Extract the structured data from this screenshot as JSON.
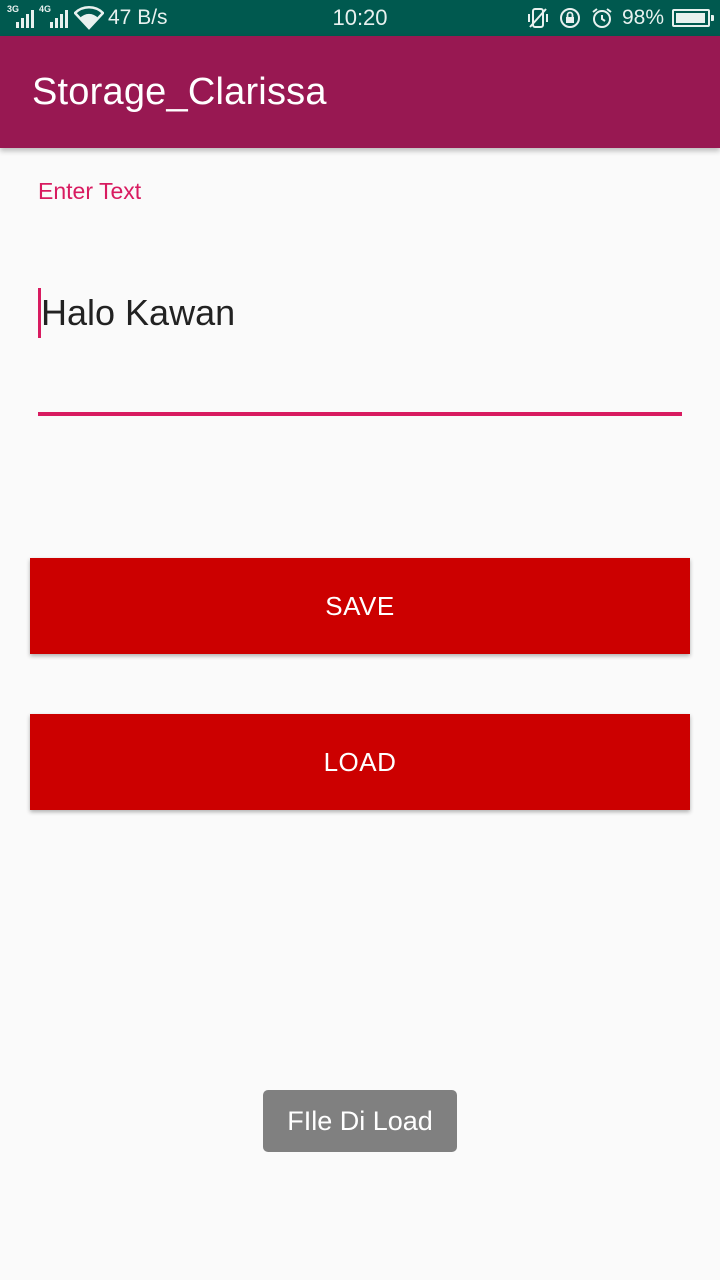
{
  "status_bar": {
    "network_speed": "47 B/s",
    "time": "10:20",
    "battery_percent": "98%",
    "battery_level": 0.98,
    "signal_tags": [
      "3G",
      "4G"
    ],
    "icons": [
      "signal-icon",
      "wifi-icon",
      "vibrate-icon",
      "rotation-lock-icon",
      "alarm-icon",
      "battery-icon"
    ]
  },
  "app_bar": {
    "title": "Storage_Clarissa",
    "color": "#981852"
  },
  "form": {
    "label": "Enter Text",
    "value": "Halo Kawan",
    "accent_color": "#d81b60"
  },
  "buttons": {
    "save_label": "SAVE",
    "load_label": "LOAD",
    "color": "#cc0000"
  },
  "toast": {
    "message": "FIle Di Load"
  }
}
